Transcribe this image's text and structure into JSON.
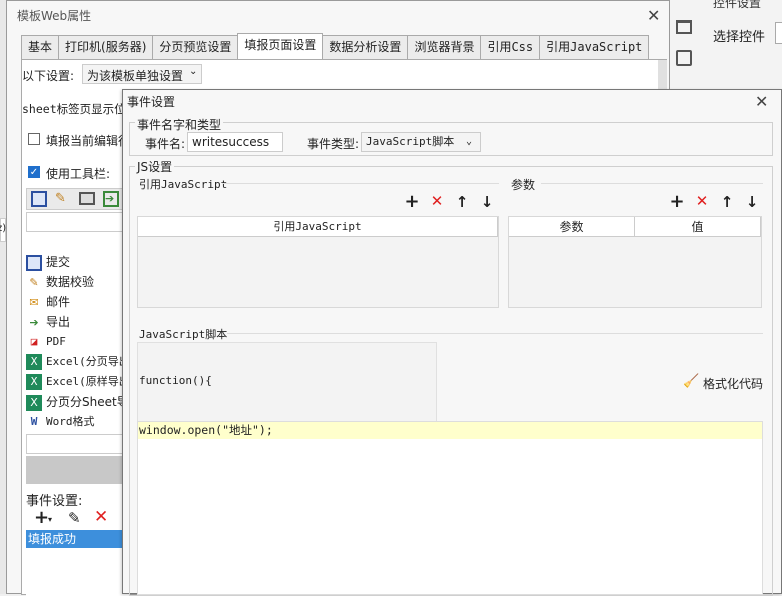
{
  "colors": {
    "accent": "#3399ff",
    "selection": "#3d8fdc",
    "highlight_line": "#ffffcc",
    "delete_red": "#e02020"
  },
  "right_panel": {
    "top_label": "控件设置",
    "select_label": "选择控件"
  },
  "outer_dialog": {
    "title": "模板Web属性",
    "tabs": [
      "基本",
      "打印机(服务器)",
      "分页预览设置",
      "填报页面设置",
      "数据分析设置",
      "浏览器背景",
      "引用Css",
      "引用JavaScript"
    ],
    "active_tab": "填报页面设置",
    "settings_label": "以下设置:",
    "settings_value": "为该模板单独设置",
    "sheet_label": "sheet标签页显示位",
    "fill_current_label": "填报当前编辑行",
    "use_toolbar_label": "使用工具栏:",
    "toolbar_items": [
      "提交",
      "数据校验",
      "邮件",
      "导出",
      "PDF",
      "Excel(分页导出",
      "Excel(原样导出",
      "分页分Sheet导",
      "Word格式"
    ],
    "event_settings_label": "事件设置:",
    "event_list": [
      "填报成功"
    ],
    "left_edge_text": "z)"
  },
  "event_dialog": {
    "title": "事件设置",
    "name_type_group": "事件名字和类型",
    "event_name_label": "事件名:",
    "event_name_value": "writesuccess",
    "event_type_label": "事件类型:",
    "event_type_value": "JavaScript脚本",
    "js_group": "JS设置",
    "ref_js_label": "引用JavaScript",
    "params_label": "参数",
    "ref_js_col": "引用JavaScript",
    "param_col": "参数",
    "value_col": "值",
    "script_label": "JavaScript脚本",
    "function_header": "function(){",
    "format_code": "格式化代码",
    "code_line": "window.open(\"地址\");"
  }
}
